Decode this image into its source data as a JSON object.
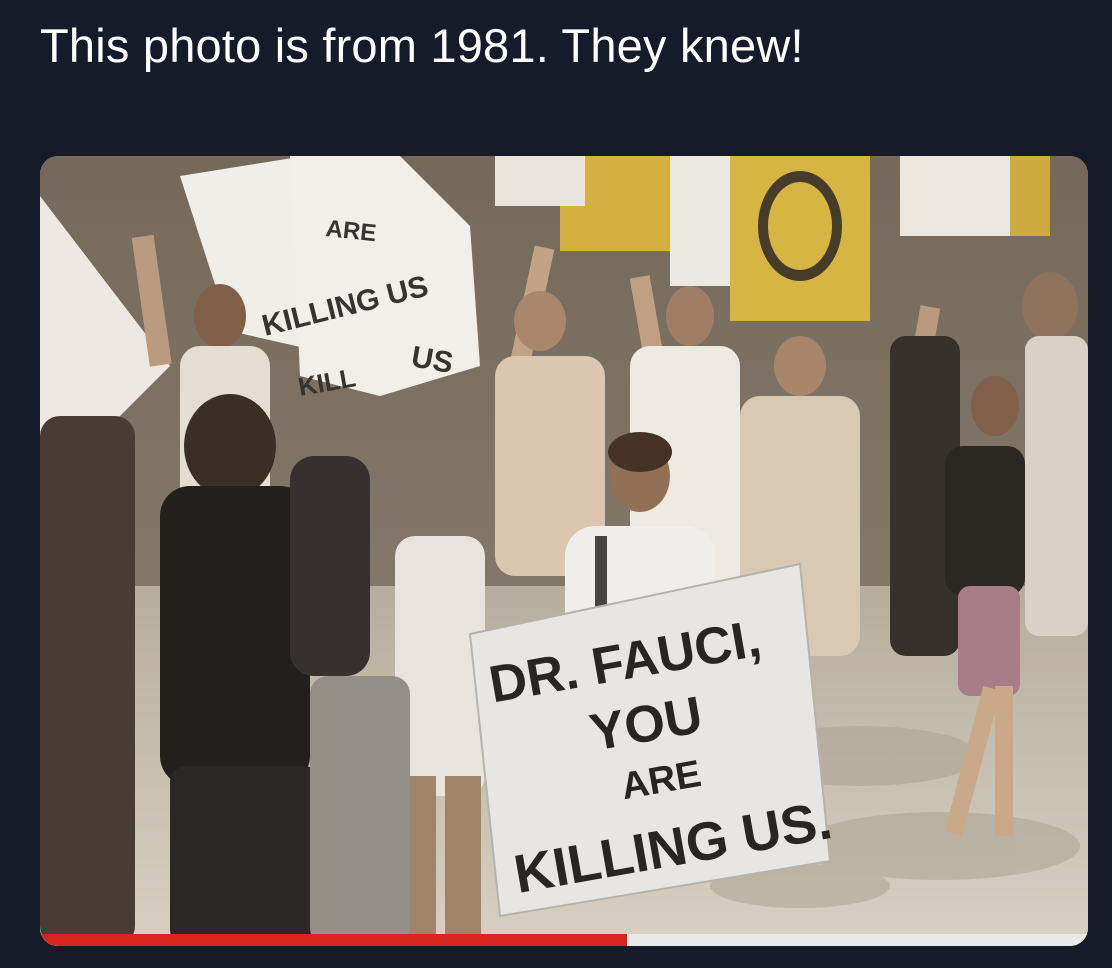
{
  "caption": "This photo is from 1981. They knew!",
  "photo": {
    "hero_sign": {
      "line1": "DR. FAUCI,",
      "line2": "YOU",
      "line3": "ARE",
      "line4": "KILLING US."
    },
    "background_signs": {
      "sign_a_line1": "ARE",
      "sign_a_line2": "KILLING US",
      "sign_b": "US",
      "sign_c": "KILL"
    }
  },
  "video_progress": {
    "fraction": 0.56,
    "colors": {
      "played": "#d8261f",
      "track": "#e9e9e9"
    }
  }
}
